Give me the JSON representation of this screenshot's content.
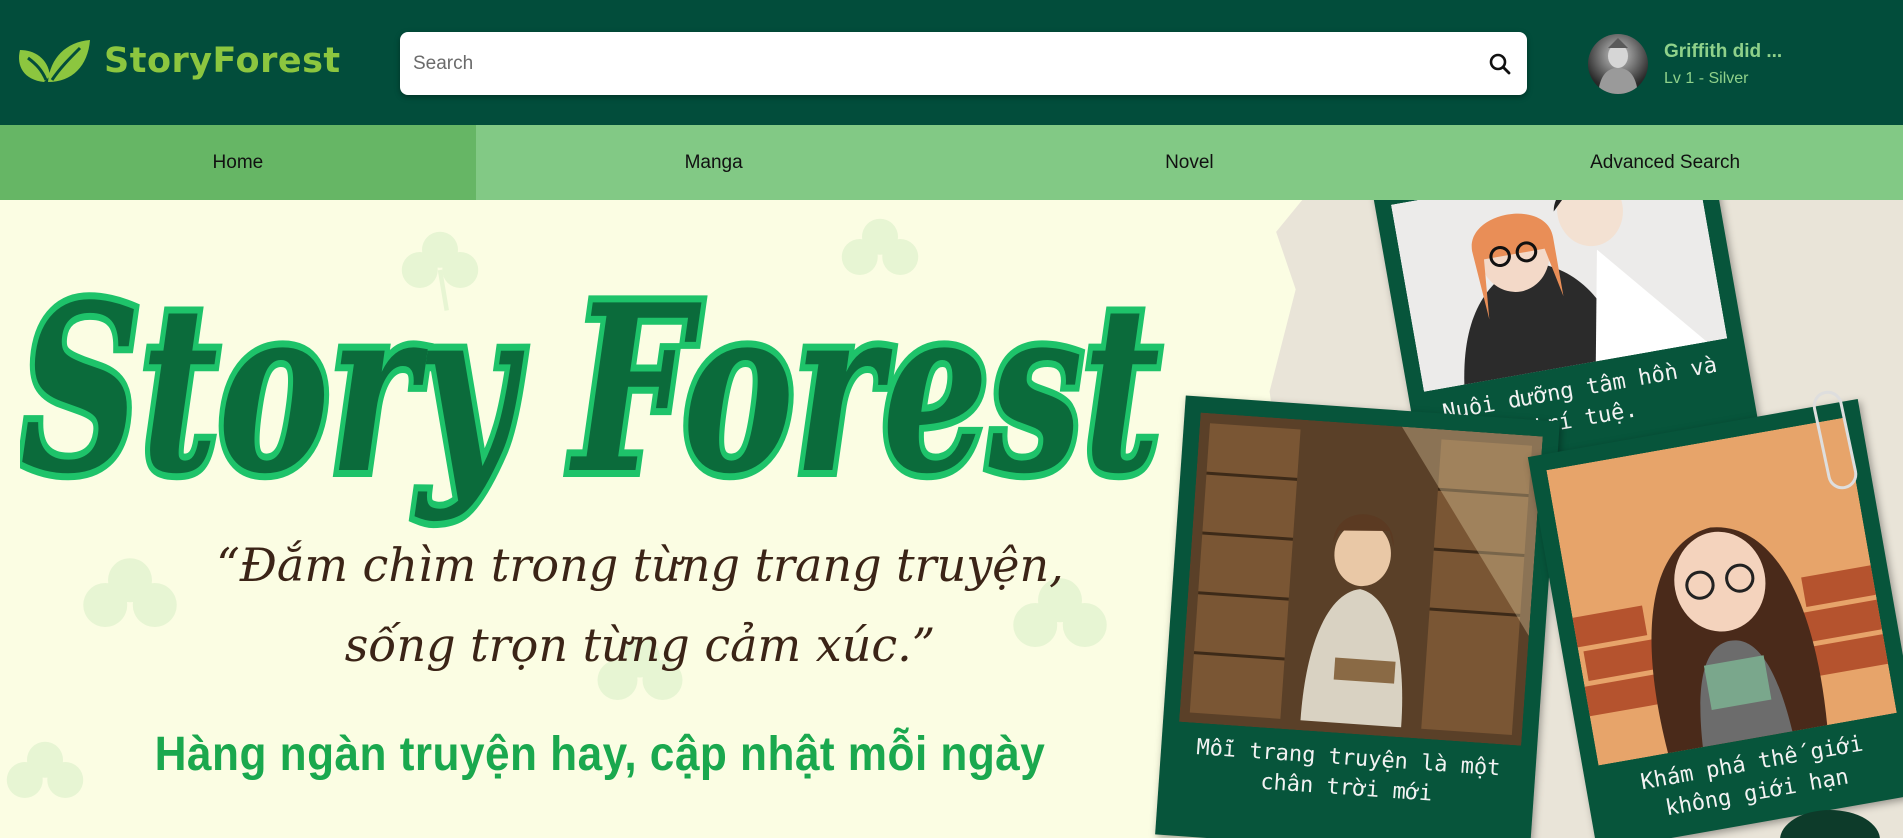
{
  "header": {
    "logo_text": "StoryForest",
    "search": {
      "placeholder": "Search",
      "value": ""
    },
    "search_icon": "search-icon",
    "user": {
      "name": "Griffith did ...",
      "level": "Lv 1 - Silver"
    }
  },
  "nav": {
    "items": [
      {
        "label": "Home",
        "active": true
      },
      {
        "label": "Manga",
        "active": false
      },
      {
        "label": "Novel",
        "active": false
      },
      {
        "label": "Advanced Search",
        "active": false
      }
    ]
  },
  "banner": {
    "title": "Story Forest",
    "quote_line1": "“Đắm chìm trong từng trang truyện,",
    "quote_line2": "sống trọn từng cảm xúc.”",
    "tagline": "Hàng ngàn truyện hay, cập nhật mỗi ngày",
    "cards": [
      {
        "caption": "Nuôi dưỡng tâm hồn và trí tuệ."
      },
      {
        "caption": "Mỗi trang truyện là một chân trời mới"
      },
      {
        "caption": "Khám phá thế giới không giới hạn"
      }
    ]
  },
  "colors": {
    "header_bg": "#024d3b",
    "nav_bg": "#82c985",
    "nav_active_bg": "#66b665",
    "logo_green": "#8cc63f",
    "banner_bg": "#fbfde3",
    "title_dark": "#0b6b3b",
    "title_light": "#1ec36a",
    "tagline": "#1aa84e"
  }
}
